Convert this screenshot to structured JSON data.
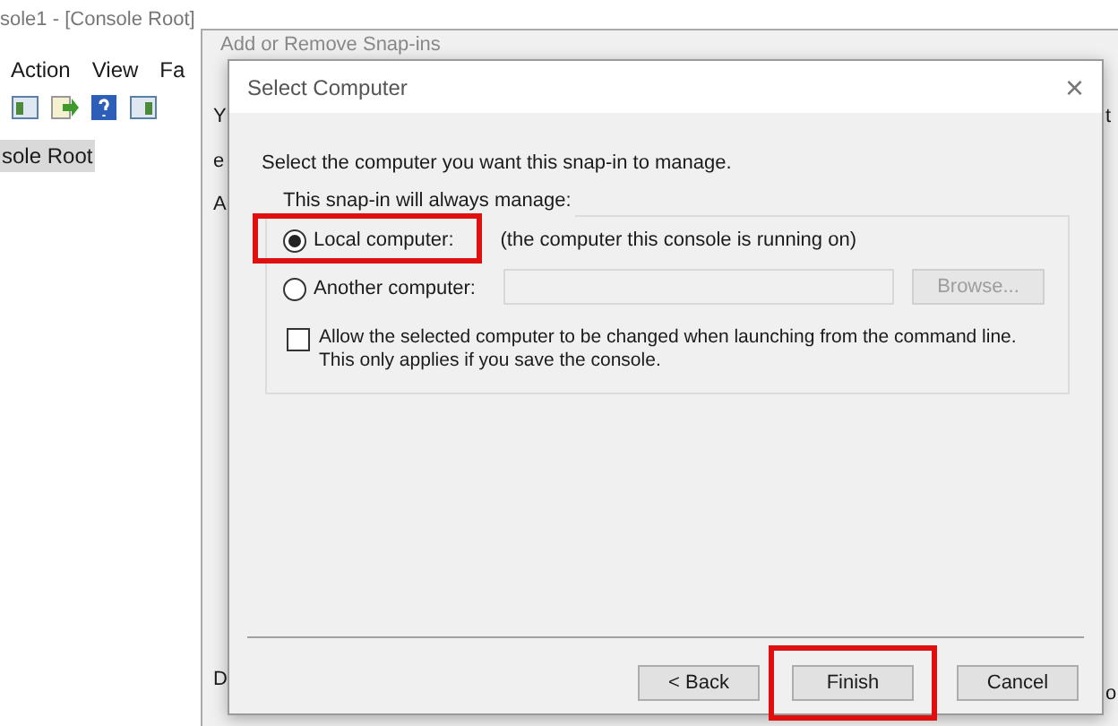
{
  "console_window": {
    "title": "sole1 - [Console Root]",
    "menu": [
      "Action",
      "View",
      "Fa"
    ],
    "tree": [
      {
        "label": "sole Root",
        "selected": true
      }
    ]
  },
  "snapins_window": {
    "title": "Add or Remove Snap-ins",
    "left_fragments": [
      "Y",
      "e",
      "A",
      "D"
    ],
    "right_fragments": [
      "t",
      "o"
    ]
  },
  "dialog": {
    "title": "Select Computer",
    "close": "×",
    "instruction": "Select the computer you want this snap-in to manage.",
    "group_label": "This snap-in will always manage:",
    "options": [
      {
        "kind": "radio",
        "label": "Local computer:",
        "note": "(the computer this console is running on)",
        "selected": true,
        "highlighted": true
      },
      {
        "kind": "radio",
        "label": "Another computer:",
        "selected": false,
        "highlighted": false
      }
    ],
    "computer_field": {
      "disabled": true
    },
    "browse_button": {
      "label": "Browse...",
      "disabled": true
    },
    "allow_change": {
      "label": "Allow the selected computer to be changed when launching from the command line.  This only applies if you save the console.",
      "checked": false
    },
    "buttons": [
      {
        "label": "< Back",
        "highlighted": false
      },
      {
        "label": "Finish",
        "highlighted": true
      },
      {
        "label": "Cancel",
        "highlighted": false
      }
    ]
  }
}
